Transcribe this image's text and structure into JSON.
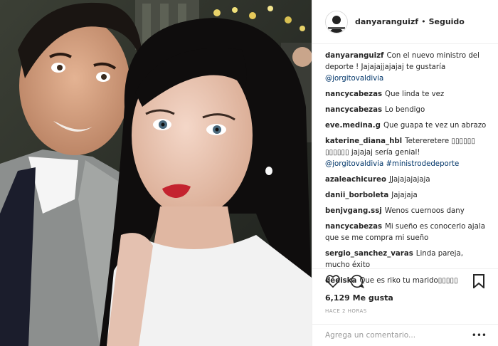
{
  "header": {
    "username": "danyaranguizf",
    "separator": "•",
    "follow_status": "Seguido"
  },
  "comments": [
    {
      "user": "danyaranguizf",
      "text": "Con el nuevo ministro del deporte ! Jajajajjajajaj te gustaría",
      "mention": "@jorgitovaldivia"
    },
    {
      "user": "nancycabezas",
      "text": "Que linda te vez"
    },
    {
      "user": "nancycabezas",
      "text": "Lo bendigo"
    },
    {
      "user": "eve.medina.g",
      "text": "Que guapa te vez un abrazo"
    },
    {
      "user": "katerine_diana_hbl",
      "text": "Tetereretere ▯▯▯▯▯▯ ▯▯▯▯▯▯ jajajaj sería genial!",
      "mention": "@jorgitovaldivia #ministrodedeporte"
    },
    {
      "user": "azaleachicureo",
      "text": "JJajajajajaja"
    },
    {
      "user": "danii_borboleta",
      "text": "Jajajaja"
    },
    {
      "user": "benjvgang.ssj",
      "text": "Wenos cuernoos dany"
    },
    {
      "user": "nancycabezas",
      "text": "Mi sueño es conocerlo ajala que se me compra mi sueño"
    },
    {
      "user": "sergio_sanchez_varas",
      "text": "Linda pareja, mucho éxito"
    },
    {
      "user": "deeiska",
      "text": "Que es riko tu marido▯▯▯▯▯"
    }
  ],
  "actions": {
    "like_icon": "heart-icon",
    "comment_icon": "comment-bubble-icon",
    "save_icon": "bookmark-icon"
  },
  "likes": "6,129 Me gusta",
  "timestamp": "HACE 2 HORAS",
  "comment_box": {
    "placeholder": "Agrega un comentario...",
    "more_label": "•••"
  }
}
